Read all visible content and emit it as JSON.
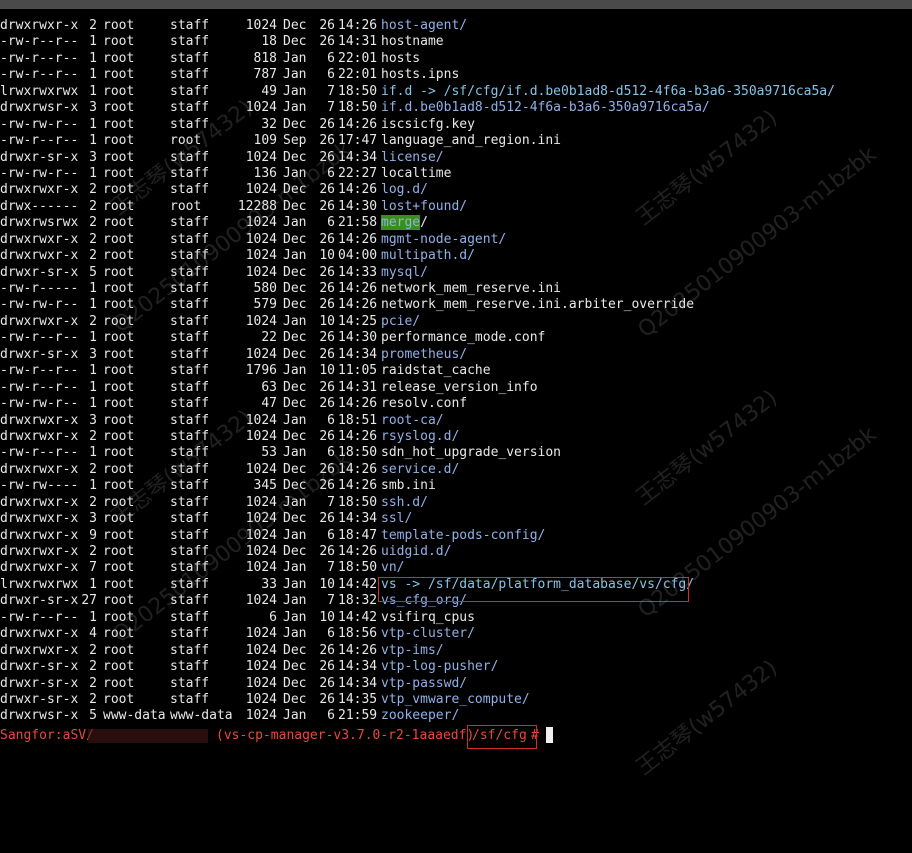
{
  "listing": [
    {
      "perm": "drwxrwxr-x",
      "links": "2",
      "owner": "root",
      "group": "staff",
      "size": "1024",
      "month": "Dec",
      "day": "26",
      "time": "14:26",
      "name": "host-agent/",
      "kind": "dir"
    },
    {
      "perm": "-rw-r--r--",
      "links": "1",
      "owner": "root",
      "group": "staff",
      "size": "18",
      "month": "Dec",
      "day": "26",
      "time": "14:31",
      "name": "hostname",
      "kind": "file"
    },
    {
      "perm": "-rw-r--r--",
      "links": "1",
      "owner": "root",
      "group": "staff",
      "size": "818",
      "month": "Jan",
      "day": "6",
      "time": "22:01",
      "name": "hosts",
      "kind": "file"
    },
    {
      "perm": "-rw-r--r--",
      "links": "1",
      "owner": "root",
      "group": "staff",
      "size": "787",
      "month": "Jan",
      "day": "6",
      "time": "22:01",
      "name": "hosts.ipns",
      "kind": "file"
    },
    {
      "perm": "lrwxrwxrwx",
      "links": "1",
      "owner": "root",
      "group": "staff",
      "size": "49",
      "month": "Jan",
      "day": "7",
      "time": "18:50",
      "name": "if.d -> /sf/cfg/if.d.be0b1ad8-d512-4f6a-b3a6-350a9716ca5a/",
      "kind": "link"
    },
    {
      "perm": "drwxrwsr-x",
      "links": "3",
      "owner": "root",
      "group": "staff",
      "size": "1024",
      "month": "Jan",
      "day": "7",
      "time": "18:50",
      "name": "if.d.be0b1ad8-d512-4f6a-b3a6-350a9716ca5a/",
      "kind": "dir"
    },
    {
      "perm": "-rw-rw-r--",
      "links": "1",
      "owner": "root",
      "group": "staff",
      "size": "32",
      "month": "Dec",
      "day": "26",
      "time": "14:26",
      "name": "iscsicfg.key",
      "kind": "file"
    },
    {
      "perm": "-rw-r--r--",
      "links": "1",
      "owner": "root",
      "group": "root",
      "size": "109",
      "month": "Sep",
      "day": "26",
      "time": "17:47",
      "name": "language_and_region.ini",
      "kind": "file"
    },
    {
      "perm": "drwxr-sr-x",
      "links": "3",
      "owner": "root",
      "group": "staff",
      "size": "1024",
      "month": "Dec",
      "day": "26",
      "time": "14:34",
      "name": "license/",
      "kind": "dir"
    },
    {
      "perm": "-rw-rw-r--",
      "links": "1",
      "owner": "root",
      "group": "staff",
      "size": "136",
      "month": "Jan",
      "day": "6",
      "time": "22:27",
      "name": "localtime",
      "kind": "file"
    },
    {
      "perm": "drwxrwxr-x",
      "links": "2",
      "owner": "root",
      "group": "staff",
      "size": "1024",
      "month": "Dec",
      "day": "26",
      "time": "14:26",
      "name": "log.d/",
      "kind": "dir"
    },
    {
      "perm": "drwx------",
      "links": "2",
      "owner": "root",
      "group": "root",
      "size": "12288",
      "month": "Dec",
      "day": "26",
      "time": "14:30",
      "name": "lost+found/",
      "kind": "dir"
    },
    {
      "perm": "drwxrwsrwx",
      "links": "2",
      "owner": "root",
      "group": "staff",
      "size": "1024",
      "month": "Jan",
      "day": "6",
      "time": "21:58",
      "name": "merge/",
      "kind": "sticky"
    },
    {
      "perm": "drwxrwxr-x",
      "links": "2",
      "owner": "root",
      "group": "staff",
      "size": "1024",
      "month": "Dec",
      "day": "26",
      "time": "14:26",
      "name": "mgmt-node-agent/",
      "kind": "dir"
    },
    {
      "perm": "drwxrwxr-x",
      "links": "2",
      "owner": "root",
      "group": "staff",
      "size": "1024",
      "month": "Jan",
      "day": "10",
      "time": "04:00",
      "name": "multipath.d/",
      "kind": "dir"
    },
    {
      "perm": "drwxr-sr-x",
      "links": "5",
      "owner": "root",
      "group": "staff",
      "size": "1024",
      "month": "Dec",
      "day": "26",
      "time": "14:33",
      "name": "mysql/",
      "kind": "dir"
    },
    {
      "perm": "-rw-r-----",
      "links": "1",
      "owner": "root",
      "group": "staff",
      "size": "580",
      "month": "Dec",
      "day": "26",
      "time": "14:26",
      "name": "network_mem_reserve.ini",
      "kind": "file"
    },
    {
      "perm": "-rw-rw-r--",
      "links": "1",
      "owner": "root",
      "group": "staff",
      "size": "579",
      "month": "Dec",
      "day": "26",
      "time": "14:26",
      "name": "network_mem_reserve.ini.arbiter_override",
      "kind": "file"
    },
    {
      "perm": "drwxrwxr-x",
      "links": "2",
      "owner": "root",
      "group": "staff",
      "size": "1024",
      "month": "Jan",
      "day": "10",
      "time": "14:25",
      "name": "pcie/",
      "kind": "dir"
    },
    {
      "perm": "-rw-r--r--",
      "links": "1",
      "owner": "root",
      "group": "staff",
      "size": "22",
      "month": "Dec",
      "day": "26",
      "time": "14:30",
      "name": "performance_mode.conf",
      "kind": "file"
    },
    {
      "perm": "drwxr-sr-x",
      "links": "3",
      "owner": "root",
      "group": "staff",
      "size": "1024",
      "month": "Dec",
      "day": "26",
      "time": "14:34",
      "name": "prometheus/",
      "kind": "dir"
    },
    {
      "perm": "-rw-r--r--",
      "links": "1",
      "owner": "root",
      "group": "staff",
      "size": "1796",
      "month": "Jan",
      "day": "10",
      "time": "11:05",
      "name": "raidstat_cache",
      "kind": "file"
    },
    {
      "perm": "-rw-r--r--",
      "links": "1",
      "owner": "root",
      "group": "staff",
      "size": "63",
      "month": "Dec",
      "day": "26",
      "time": "14:31",
      "name": "release_version_info",
      "kind": "file"
    },
    {
      "perm": "-rw-rw-r--",
      "links": "1",
      "owner": "root",
      "group": "staff",
      "size": "47",
      "month": "Dec",
      "day": "26",
      "time": "14:26",
      "name": "resolv.conf",
      "kind": "file"
    },
    {
      "perm": "drwxrwxr-x",
      "links": "3",
      "owner": "root",
      "group": "staff",
      "size": "1024",
      "month": "Jan",
      "day": "6",
      "time": "18:51",
      "name": "root-ca/",
      "kind": "dir"
    },
    {
      "perm": "drwxrwxr-x",
      "links": "2",
      "owner": "root",
      "group": "staff",
      "size": "1024",
      "month": "Dec",
      "day": "26",
      "time": "14:26",
      "name": "rsyslog.d/",
      "kind": "dir"
    },
    {
      "perm": "-rw-r--r--",
      "links": "1",
      "owner": "root",
      "group": "staff",
      "size": "53",
      "month": "Jan",
      "day": "6",
      "time": "18:50",
      "name": "sdn_hot_upgrade_version",
      "kind": "file"
    },
    {
      "perm": "drwxrwxr-x",
      "links": "2",
      "owner": "root",
      "group": "staff",
      "size": "1024",
      "month": "Dec",
      "day": "26",
      "time": "14:26",
      "name": "service.d/",
      "kind": "dir"
    },
    {
      "perm": "-rw-rw----",
      "links": "1",
      "owner": "root",
      "group": "staff",
      "size": "345",
      "month": "Dec",
      "day": "26",
      "time": "14:26",
      "name": "smb.ini",
      "kind": "file"
    },
    {
      "perm": "drwxrwxr-x",
      "links": "2",
      "owner": "root",
      "group": "staff",
      "size": "1024",
      "month": "Jan",
      "day": "7",
      "time": "18:50",
      "name": "ssh.d/",
      "kind": "dir"
    },
    {
      "perm": "drwxrwxr-x",
      "links": "3",
      "owner": "root",
      "group": "staff",
      "size": "1024",
      "month": "Dec",
      "day": "26",
      "time": "14:34",
      "name": "ssl/",
      "kind": "dir"
    },
    {
      "perm": "drwxrwxr-x",
      "links": "9",
      "owner": "root",
      "group": "staff",
      "size": "1024",
      "month": "Jan",
      "day": "6",
      "time": "18:47",
      "name": "template-pods-config/",
      "kind": "dir"
    },
    {
      "perm": "drwxrwxr-x",
      "links": "2",
      "owner": "root",
      "group": "staff",
      "size": "1024",
      "month": "Dec",
      "day": "26",
      "time": "14:26",
      "name": "uidgid.d/",
      "kind": "dir"
    },
    {
      "perm": "drwxrwxr-x",
      "links": "7",
      "owner": "root",
      "group": "staff",
      "size": "1024",
      "month": "Jan",
      "day": "7",
      "time": "18:50",
      "name": "vn/",
      "kind": "dir"
    },
    {
      "perm": "lrwxrwxrwx",
      "links": "1",
      "owner": "root",
      "group": "staff",
      "size": "33",
      "month": "Jan",
      "day": "10",
      "time": "14:42",
      "name": "vs -> /sf/data/platform_database/vs/cfg/",
      "kind": "link"
    },
    {
      "perm": "drwxr-sr-x",
      "links": "27",
      "owner": "root",
      "group": "staff",
      "size": "1024",
      "month": "Jan",
      "day": "7",
      "time": "18:32",
      "name": "vs_cfg_org/",
      "kind": "dir"
    },
    {
      "perm": "-rw-r--r--",
      "links": "1",
      "owner": "root",
      "group": "staff",
      "size": "6",
      "month": "Jan",
      "day": "10",
      "time": "14:42",
      "name": "vsifirq_cpus",
      "kind": "file"
    },
    {
      "perm": "drwxrwxr-x",
      "links": "4",
      "owner": "root",
      "group": "staff",
      "size": "1024",
      "month": "Jan",
      "day": "6",
      "time": "18:56",
      "name": "vtp-cluster/",
      "kind": "dir"
    },
    {
      "perm": "drwxrwxr-x",
      "links": "2",
      "owner": "root",
      "group": "staff",
      "size": "1024",
      "month": "Dec",
      "day": "26",
      "time": "14:26",
      "name": "vtp-ims/",
      "kind": "dir"
    },
    {
      "perm": "drwxr-sr-x",
      "links": "2",
      "owner": "root",
      "group": "staff",
      "size": "1024",
      "month": "Dec",
      "day": "26",
      "time": "14:34",
      "name": "vtp-log-pusher/",
      "kind": "dir"
    },
    {
      "perm": "drwxr-sr-x",
      "links": "2",
      "owner": "root",
      "group": "staff",
      "size": "1024",
      "month": "Dec",
      "day": "26",
      "time": "14:34",
      "name": "vtp-passwd/",
      "kind": "dir"
    },
    {
      "perm": "drwxr-sr-x",
      "links": "2",
      "owner": "root",
      "group": "staff",
      "size": "1024",
      "month": "Dec",
      "day": "26",
      "time": "14:35",
      "name": "vtp_vmware_compute/",
      "kind": "dir"
    },
    {
      "perm": "drwxrwsr-x",
      "links": "5",
      "owner": "www-data",
      "group": "www-data",
      "size": "1024",
      "month": "Jan",
      "day": "6",
      "time": "21:59",
      "name": "zookeeper/",
      "kind": "dir"
    }
  ],
  "prompt": {
    "host": "Sangfor:aSV/",
    "env": "(vs-cp-manager-v3.7.0-r2-1aaaedf)",
    "path": "/sf/cfg",
    "symbol": "#"
  },
  "watermark": {
    "name": "王志琴(w57432)",
    "id": "Q2025010900903-m1bzbk"
  },
  "colors": {
    "background": "#000000",
    "directory": "#8fb1e8",
    "symlink": "#85c4e8",
    "prompt": "#e84a3a",
    "highlight_box": "#d42a2a",
    "sticky_dir_bg": "#3a8f1a"
  }
}
